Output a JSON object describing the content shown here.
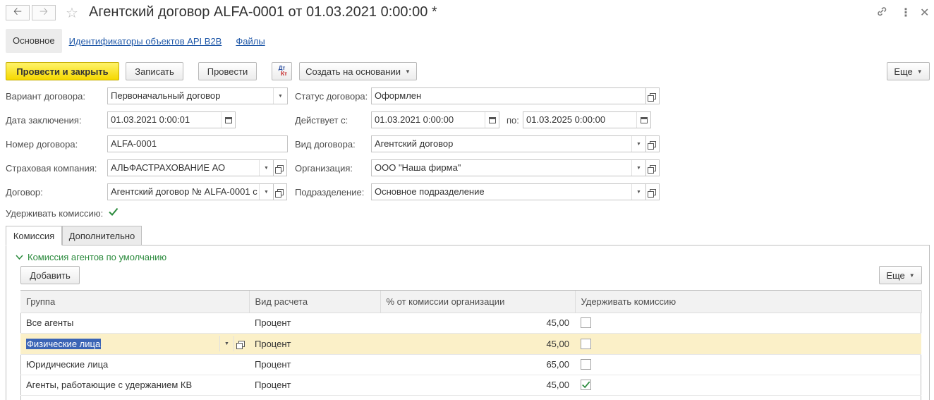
{
  "window": {
    "title": "Агентский договор ALFA-0001 от 01.03.2021 0:00:00 *"
  },
  "nav": {
    "back": "back-arrow-icon",
    "forward": "forward-arrow-icon"
  },
  "tabs_top": {
    "main": "Основное",
    "api": "Идентификаторы объектов API B2B",
    "files": "Файлы"
  },
  "toolbar": {
    "post_close": "Провести и закрыть",
    "save": "Записать",
    "post": "Провести",
    "dtkt": "Дт Кт",
    "create_based": "Создать на основании",
    "more": "Еще"
  },
  "form": {
    "variant_label": "Вариант договора:",
    "variant_value": "Первоначальный договор",
    "status_label": "Статус договора:",
    "status_value": "Оформлен",
    "date_label": "Дата заключения:",
    "date_value": "01.03.2021  0:00:01",
    "valid_from_label": "Действует с:",
    "valid_from_value": "01.03.2021  0:00:00",
    "valid_to_label": "по:",
    "valid_to_value": "01.03.2025  0:00:00",
    "number_label": "Номер договора:",
    "number_value": "ALFA-0001",
    "kind_label": "Вид договора:",
    "kind_value": "Агентский договор",
    "insurer_label": "Страховая компания:",
    "insurer_value": "АЛЬФАСТРАХОВАНИЕ АО",
    "org_label": "Организация:",
    "org_value": "ООО \"Наша фирма\"",
    "contract_label": "Договор:",
    "contract_value": "Агентский договор № ALFA-0001 с",
    "dept_label": "Подразделение:",
    "dept_value": "Основное подразделение",
    "withhold_label": "Удерживать комиссию:",
    "withhold_checked": true
  },
  "tabs": {
    "commission": "Комиссия",
    "extra": "Дополнительно"
  },
  "commission": {
    "group_title": "Комиссия агентов по умолчанию",
    "add": "Добавить",
    "more": "Еще",
    "columns": [
      "Группа",
      "Вид расчета",
      "% от комиссии организации",
      "Удерживать комиссию"
    ],
    "rows": [
      {
        "group": "Все агенты",
        "calc": "Процент",
        "percent": "45,00",
        "withhold": false
      },
      {
        "group": "Физические лица",
        "calc": "Процент",
        "percent": "45,00",
        "withhold": false
      },
      {
        "group": "Юридические лица",
        "calc": "Процент",
        "percent": "65,00",
        "withhold": false
      },
      {
        "group": "Агенты, работающие с удержанием КВ",
        "calc": "Процент",
        "percent": "45,00",
        "withhold": true
      }
    ]
  },
  "colors": {
    "primary_button": "#f5d800",
    "link": "#1d56a7",
    "group_title": "#2a8a3c",
    "selected_row": "#fbf0c8",
    "selection": "#3b64b5"
  }
}
